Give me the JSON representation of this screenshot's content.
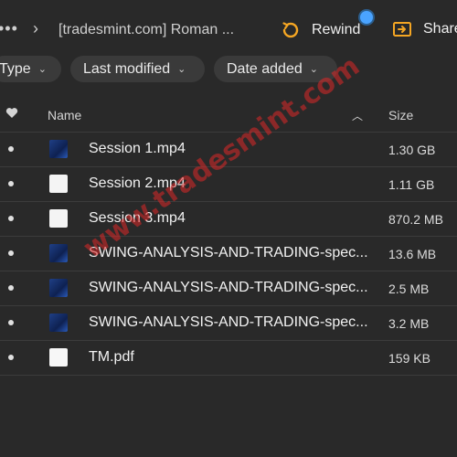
{
  "header": {
    "more_icon": "more-dots-icon",
    "breadcrumb": "[tradesmint.com] Roman ...",
    "rewind_label": "Rewind",
    "share_label": "Share"
  },
  "filters": [
    {
      "label": "Type"
    },
    {
      "label": "Last modified"
    },
    {
      "label": "Date added"
    }
  ],
  "table": {
    "col_name": "Name",
    "col_size": "Size",
    "rows": [
      {
        "name": "Session 1.mp4",
        "size": "1.30 GB",
        "thumb": "dark"
      },
      {
        "name": "Session 2.mp4",
        "size": "1.11 GB",
        "thumb": "light"
      },
      {
        "name": "Session 3.mp4",
        "size": "870.2 MB",
        "thumb": "light"
      },
      {
        "name": "SWING-ANALYSIS-AND-TRADING-spec...",
        "size": "13.6 MB",
        "thumb": "dark"
      },
      {
        "name": "SWING-ANALYSIS-AND-TRADING-spec...",
        "size": "2.5 MB",
        "thumb": "dark"
      },
      {
        "name": "SWING-ANALYSIS-AND-TRADING-spec...",
        "size": "3.2 MB",
        "thumb": "dark"
      },
      {
        "name": "TM.pdf",
        "size": "159 KB",
        "thumb": "pdf"
      }
    ]
  },
  "watermark": "www.tradesmint.com",
  "colors": {
    "rewind": "#f5a623",
    "share": "#f5a623",
    "notify_dot": "#4aa3ff"
  }
}
